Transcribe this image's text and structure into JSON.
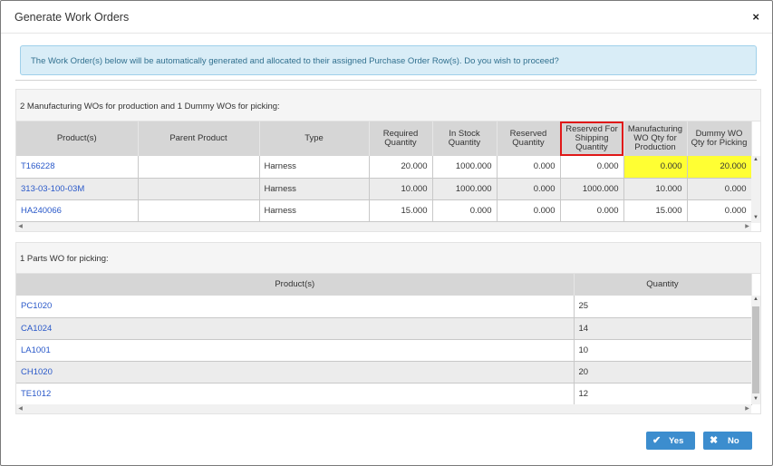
{
  "dialog": {
    "title": "Generate Work Orders",
    "close_glyph": "×"
  },
  "info_message": "The Work Order(s) below will be automatically generated and allocated to their assigned Purchase Order Row(s). Do you wish to proceed?",
  "mfg_panel": {
    "heading": "2 Manufacturing WOs for production and 1 Dummy WOs for picking:",
    "columns": [
      "Product(s)",
      "Parent Product",
      "Type",
      "Required Quantity",
      "In Stock Quantity",
      "Reserved Quantity",
      "Reserved For Shipping Quantity",
      "Manufacturing WO Qty for Production",
      "Dummy WO Qty for Picking"
    ],
    "rows": [
      [
        "T166228",
        "",
        "Harness",
        "20.000",
        "1000.000",
        "0.000",
        "0.000",
        "0.000",
        "20.000"
      ],
      [
        "313-03-100-03M",
        "",
        "Harness",
        "10.000",
        "1000.000",
        "0.000",
        "1000.000",
        "10.000",
        "0.000"
      ],
      [
        "HA240066",
        "",
        "Harness",
        "15.000",
        "0.000",
        "0.000",
        "0.000",
        "15.000",
        "0.000"
      ]
    ],
    "highlighted_column_color": "#ffff33",
    "boxed_column_color": "#e01818"
  },
  "parts_panel": {
    "heading": "1 Parts WO for picking:",
    "columns": [
      "Product(s)",
      "Quantity"
    ],
    "rows": [
      [
        "PC1020",
        "25"
      ],
      [
        "CA1024",
        "14"
      ],
      [
        "LA1001",
        "10"
      ],
      [
        "CH1020",
        "20"
      ],
      [
        "TE1012",
        "12"
      ]
    ]
  },
  "buttons": {
    "yes_label": "Yes",
    "yes_icon": "checkmark-icon",
    "no_label": "No",
    "no_icon": "x-icon",
    "color": "#3c8dce"
  },
  "colors": {
    "info_bg": "#d9edf7",
    "link": "#2a59c9",
    "header_bg": "#d6d6d6"
  }
}
